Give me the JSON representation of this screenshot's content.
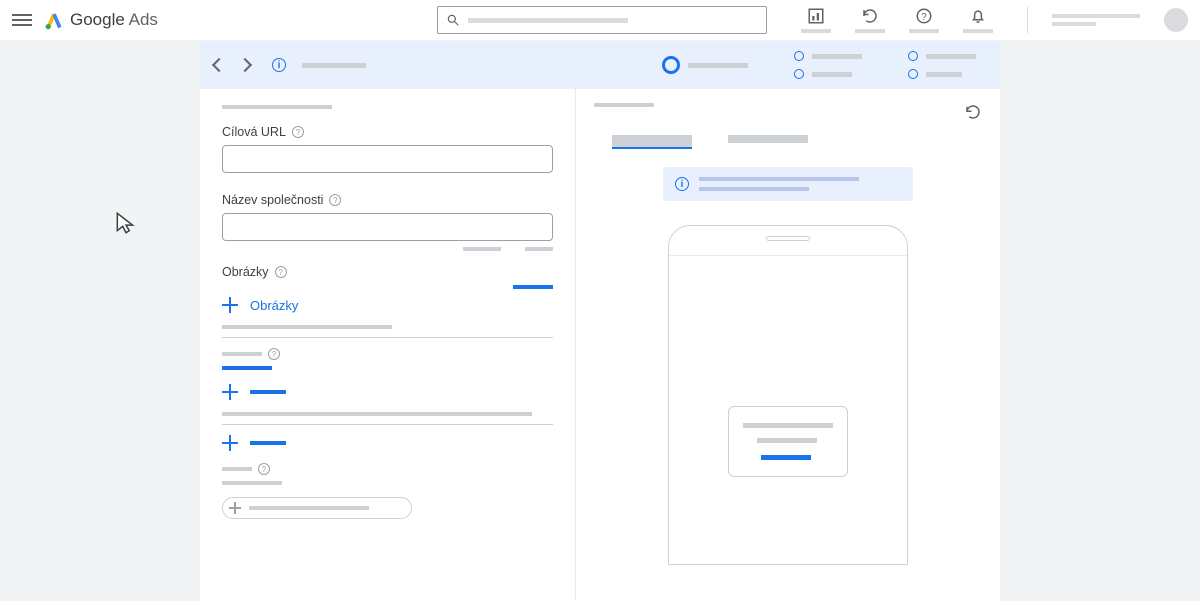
{
  "brand": {
    "google": "Google",
    "ads": "Ads"
  },
  "form": {
    "url_label": "Cílová URL",
    "company_label": "Název společnosti",
    "images_label": "Obrázky",
    "add_images": "Obrázky"
  }
}
